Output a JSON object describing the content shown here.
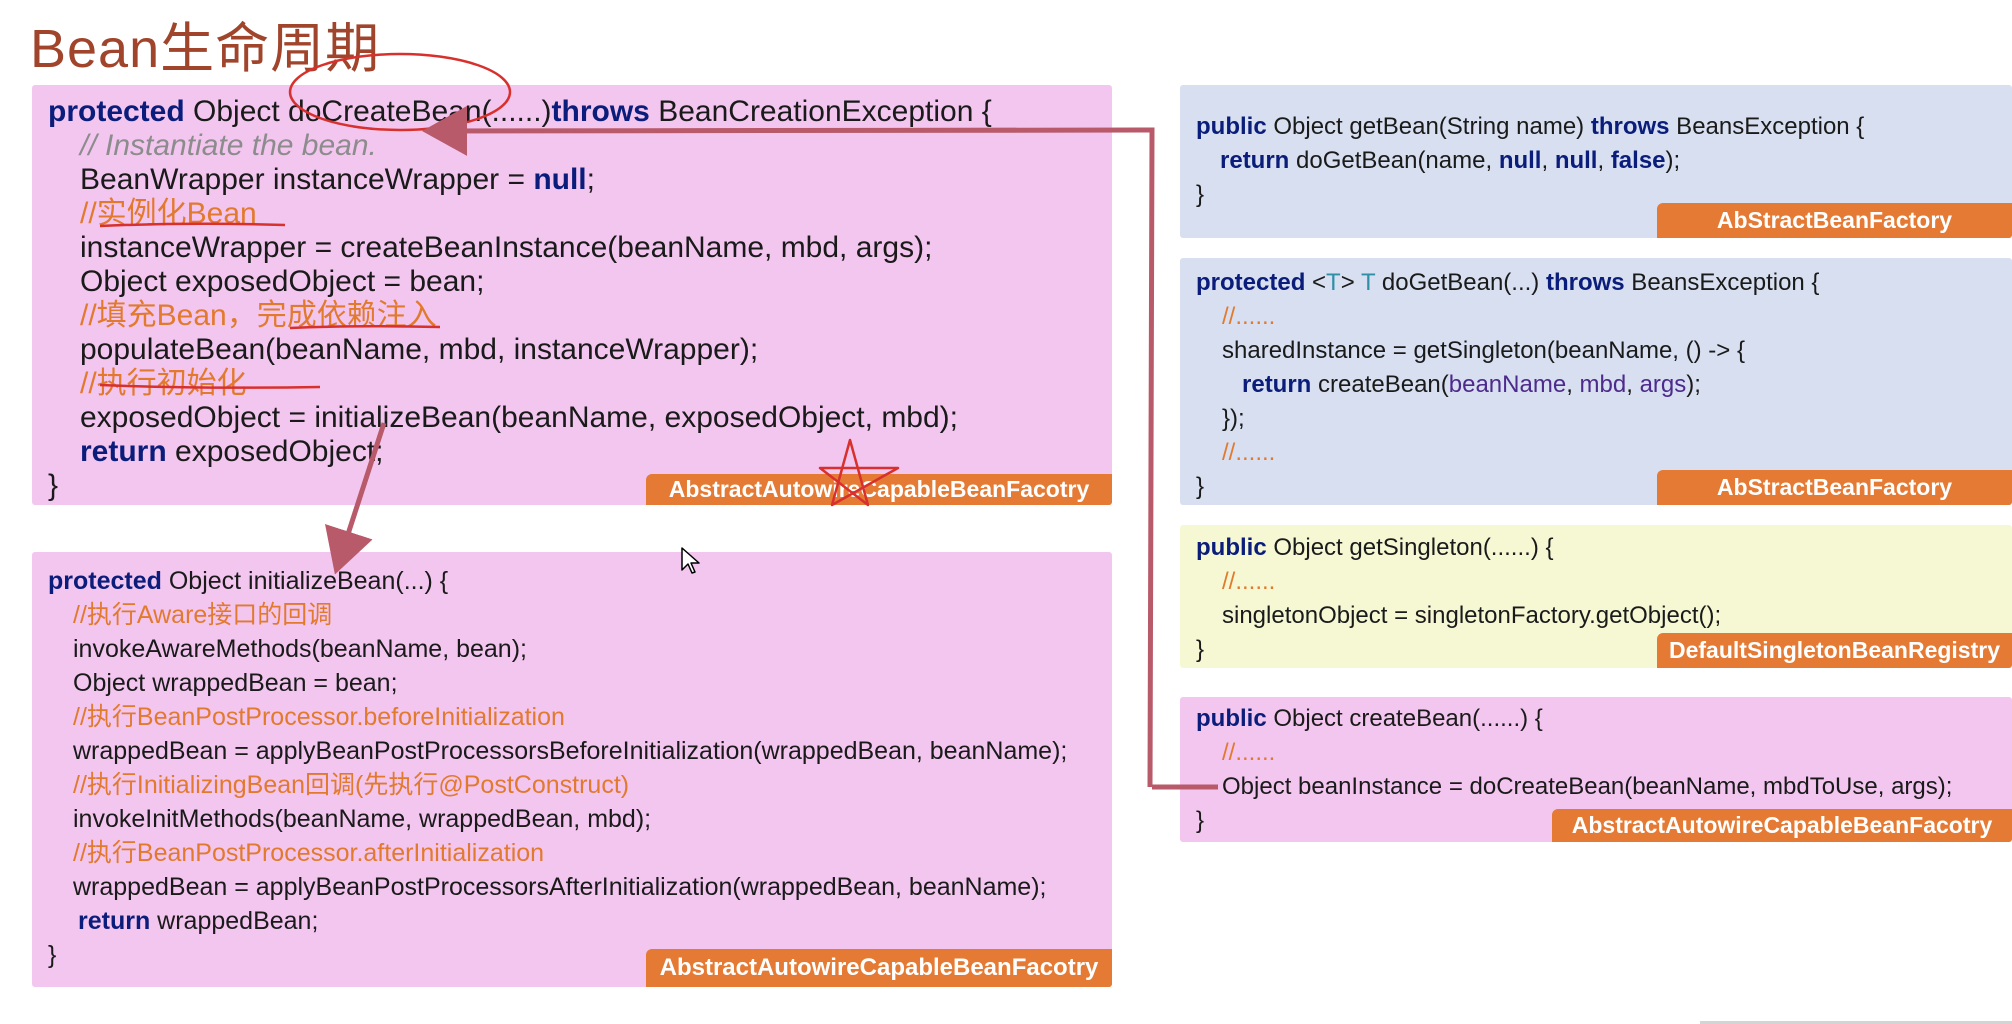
{
  "title": "Bean生命周期",
  "do_create_bean": {
    "line1": {
      "kw": "protected",
      "rest": " Object doCreateBean(......)",
      "kw2": "throws",
      "rest2": " BeanCreationException {"
    },
    "line2": "// Instantiate the bean.",
    "line3": {
      "text": "BeanWrapper instanceWrapper = ",
      "kw": "null",
      "end": ";"
    },
    "line4": "//实例化Bean",
    "line5": "instanceWrapper = createBeanInstance(beanName, mbd, args);",
    "line6": "Object exposedObject = bean;",
    "line7": "//填充Bean，完成依赖注入",
    "line8": "populateBean(beanName, mbd, instanceWrapper);",
    "line9": "//执行初始化",
    "line10": "exposedObject = initializeBean(beanName, exposedObject, mbd);",
    "line11": {
      "kw": "return",
      "rest": " exposedObject;"
    },
    "line12": "}",
    "tag": "AbstractAutowireCapableBeanFacotry"
  },
  "initialize_bean": {
    "line1": {
      "kw": "protected",
      "rest": " Object initializeBean(...) {"
    },
    "line2": "//执行Aware接口的回调",
    "line3": "invokeAwareMethods(beanName, bean);",
    "line4": "Object wrappedBean = bean;",
    "line5": "//执行BeanPostProcessor.beforeInitialization",
    "line6": "wrappedBean = applyBeanPostProcessorsBeforeInitialization(wrappedBean, beanName);",
    "line7": "//执行InitializingBean回调(先执行@PostConstruct)",
    "line8": "invokeInitMethods(beanName, wrappedBean, mbd);",
    "line9": "//执行BeanPostProcessor.afterInitialization",
    "line10": "wrappedBean = applyBeanPostProcessorsAfterInitialization(wrappedBean, beanName);",
    "line11": {
      "kw": "return",
      "rest": " wrappedBean;"
    },
    "line12": "}",
    "tag": "AbstractAutowireCapableBeanFacotry"
  },
  "get_bean": {
    "line1": {
      "kw": "public",
      "rest": " Object getBean(String name) ",
      "kw2": "throws",
      "rest2": " BeansException {"
    },
    "line2": {
      "kw": "return",
      "a": " doGetBean(name, ",
      "n1": "null",
      "c1": ", ",
      "n2": "null",
      "c2": ", ",
      "n3": "false",
      "end": ");"
    },
    "line3": "}",
    "tag": "AbStractBeanFactory"
  },
  "do_get_bean": {
    "line1": {
      "kw": "protected",
      "t1": " <",
      "tv": "T",
      "t2": "> ",
      "tv2": "T",
      "rest": " doGetBean(...) ",
      "kw2": "throws",
      "rest2": " BeansException {"
    },
    "line2": "//......",
    "line3": "sharedInstance = getSingleton(beanName, () -> {",
    "line4": {
      "kw": "return",
      "a": " createBean(",
      "p1": "beanName",
      "c1": ", ",
      "p2": "mbd",
      "c2": ", ",
      "p3": "args",
      "end": ");"
    },
    "line5": "});",
    "line6": "//......",
    "line7": "}",
    "tag": "AbStractBeanFactory"
  },
  "get_singleton": {
    "line1": {
      "kw": "public",
      "rest": " Object getSingleton(......) {"
    },
    "line2": "//......",
    "line3": "singletonObject = singletonFactory.getObject();",
    "line4": "}",
    "tag": "DefaultSingletonBeanRegistry"
  },
  "create_bean": {
    "line1": {
      "kw": "public",
      "rest": " Object createBean(......) {"
    },
    "line2": "//......",
    "line3": "Object beanInstance = doCreateBean(beanName, mbdToUse, args);",
    "line4": "}",
    "tag": "AbstractAutowireCapableBeanFacotry"
  },
  "colors": {
    "pink_panel": "#f3c6f0",
    "blue_panel": "#d7dff0",
    "yellow_panel": "#f6f8d4",
    "tag_orange": "#e47a33",
    "keyword": "#0b1d7a",
    "comment": "#e27a2e",
    "annotation_red": "#d8302c",
    "arrow": "#b85a6a"
  }
}
